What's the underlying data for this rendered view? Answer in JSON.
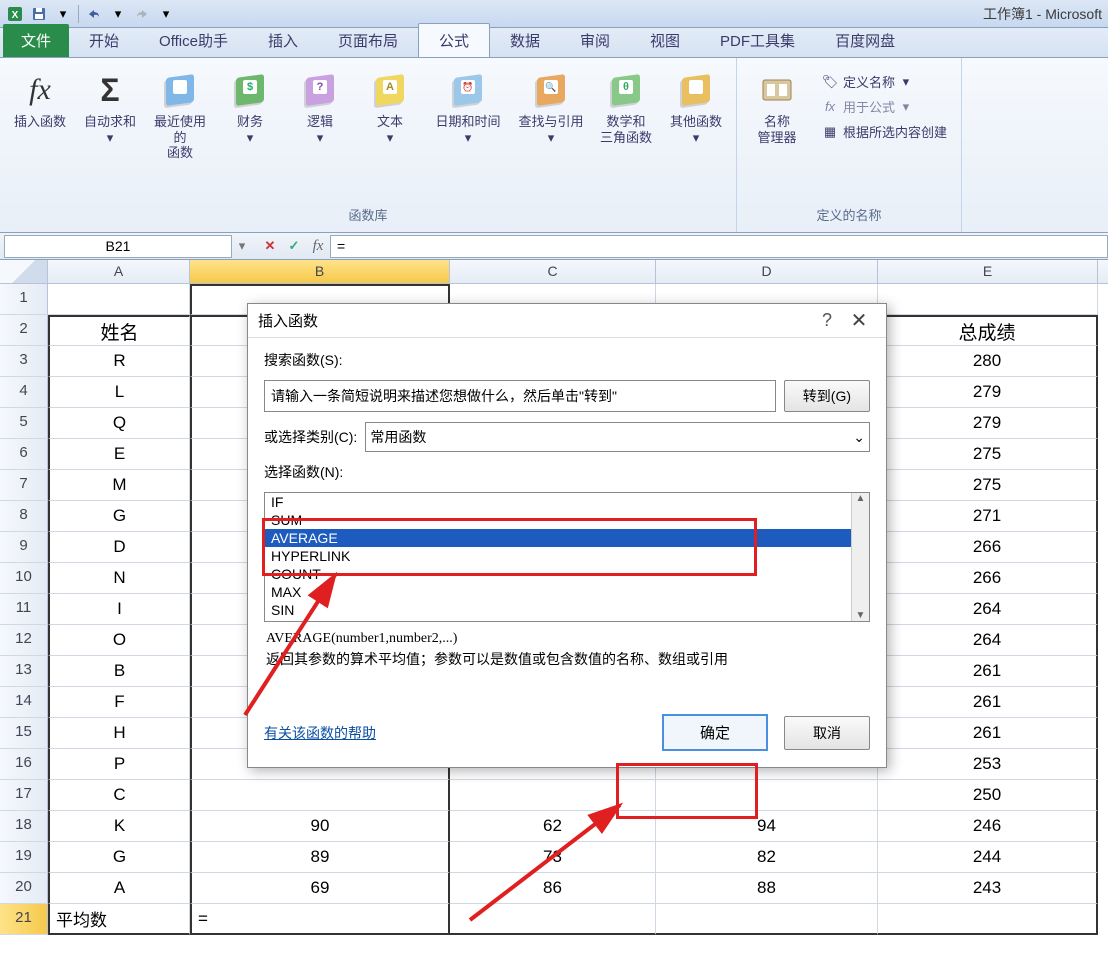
{
  "title": "工作簿1 - Microsoft",
  "qat": {
    "save": "保存",
    "undo": "撤销",
    "redo": "重做"
  },
  "tabs": {
    "file": "文件",
    "items": [
      "开始",
      "Office助手",
      "插入",
      "页面布局",
      "公式",
      "数据",
      "审阅",
      "视图",
      "PDF工具集",
      "百度网盘"
    ],
    "active": 4
  },
  "ribbon": {
    "insert_fn": {
      "label": "插入函数",
      "glyph": "fx"
    },
    "autosum": {
      "label": "自动求和",
      "glyph": "Σ"
    },
    "recent": "最近使用的\n函数",
    "financial": "财务",
    "logical": "逻辑",
    "text": "文本",
    "datetime": "日期和时间",
    "lookup": "查找与引用",
    "math": "数学和\n三角函数",
    "more": "其他函数",
    "group1_label": "函数库",
    "name_mgr": "名称\n管理器",
    "define_name": "定义名称",
    "use_in_formula": "用于公式",
    "from_selection": "根据所选内容创建",
    "group2_label": "定义的名称"
  },
  "namebox": "B21",
  "formula": "=",
  "colheads": [
    "A",
    "B",
    "C",
    "D",
    "E"
  ],
  "table": {
    "headers": {
      "A": "姓名",
      "E": "总成绩"
    },
    "rows": [
      {
        "n": 1
      },
      {
        "n": 2,
        "A": "姓名",
        "E": "总成绩",
        "hdr": true
      },
      {
        "n": 3,
        "A": "R",
        "E": "280"
      },
      {
        "n": 4,
        "A": "L",
        "E": "279"
      },
      {
        "n": 5,
        "A": "Q",
        "E": "279"
      },
      {
        "n": 6,
        "A": "E",
        "E": "275"
      },
      {
        "n": 7,
        "A": "M",
        "E": "275"
      },
      {
        "n": 8,
        "A": "G",
        "E": "271"
      },
      {
        "n": 9,
        "A": "D",
        "E": "266"
      },
      {
        "n": 10,
        "A": "N",
        "E": "266"
      },
      {
        "n": 11,
        "A": "I",
        "E": "264"
      },
      {
        "n": 12,
        "A": "O",
        "E": "264"
      },
      {
        "n": 13,
        "A": "B",
        "E": "261"
      },
      {
        "n": 14,
        "A": "F",
        "E": "261"
      },
      {
        "n": 15,
        "A": "H",
        "E": "261"
      },
      {
        "n": 16,
        "A": "P",
        "E": "253"
      },
      {
        "n": 17,
        "A": "C",
        "E": "250"
      },
      {
        "n": 18,
        "A": "K",
        "B": "90",
        "C": "62",
        "D": "94",
        "E": "246"
      },
      {
        "n": 19,
        "A": "G",
        "B": "89",
        "C": "73",
        "D": "82",
        "E": "244"
      },
      {
        "n": 20,
        "A": "A",
        "B": "69",
        "C": "86",
        "D": "88",
        "E": "243"
      },
      {
        "n": 21,
        "A": "平均数",
        "B": "=",
        "sel": true,
        "left": true
      }
    ]
  },
  "dialog": {
    "title": "插入函数",
    "search_label": "搜索函数(S):",
    "search_text": "请输入一条简短说明来描述您想做什么，然后单击\"转到\"",
    "go_btn": "转到(G)",
    "category_label": "或选择类别(C):",
    "category_value": "常用函数",
    "select_label": "选择函数(N):",
    "functions": [
      "IF",
      "SUM",
      "AVERAGE",
      "HYPERLINK",
      "COUNT",
      "MAX",
      "SIN"
    ],
    "selected_index": 2,
    "syntax": "AVERAGE(number1,number2,...)",
    "description": "返回其参数的算术平均值；参数可以是数值或包含数值的名称、数组或引用",
    "help_link": "有关该函数的帮助",
    "ok": "确定",
    "cancel": "取消"
  }
}
